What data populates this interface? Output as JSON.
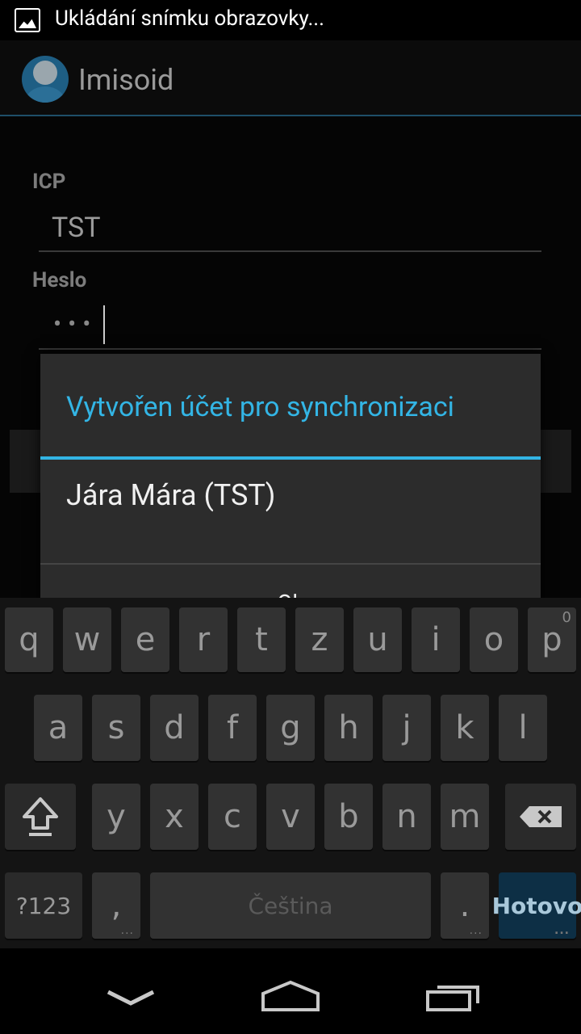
{
  "status_bar": {
    "notification_text": "Ukládání snímku obrazovky..."
  },
  "app_bar": {
    "title": "Imisoid"
  },
  "form": {
    "icp_label": "ICP",
    "icp_value": "TST",
    "password_label": "Heslo",
    "password_mask": "•••"
  },
  "dialog": {
    "title": "Vytvořen účet pro synchronizaci",
    "message": "Jára Mára (TST)",
    "ok_label": "Ok"
  },
  "keyboard": {
    "row1": [
      "q",
      "w",
      "e",
      "r",
      "t",
      "z",
      "u",
      "i",
      "o",
      "p"
    ],
    "p_hint": "0",
    "row2": [
      "a",
      "s",
      "d",
      "f",
      "g",
      "h",
      "j",
      "k",
      "l"
    ],
    "row3": [
      "y",
      "x",
      "c",
      "v",
      "b",
      "n",
      "m"
    ],
    "symbols_label": "?123",
    "comma_label": ",",
    "space_label": "Čeština",
    "period_label": ".",
    "done_label": "Hotovo"
  },
  "colors": {
    "accent": "#33b5e5",
    "dialog_bg": "#2c2c2c"
  }
}
